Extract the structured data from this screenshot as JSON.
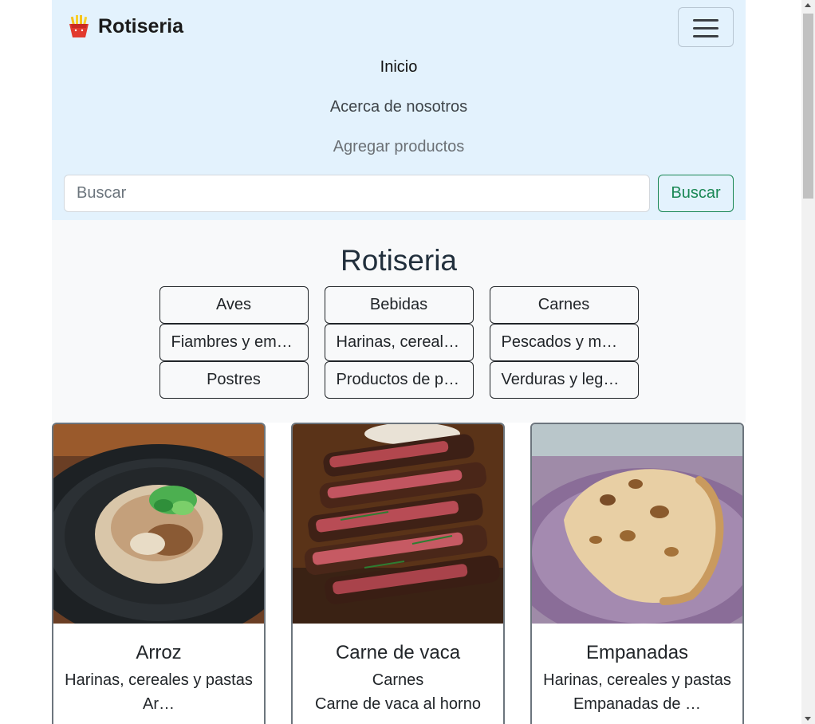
{
  "navbar": {
    "brand": "Rotiseria",
    "brand_icon": "fries-icon",
    "toggler_icon": "hamburger-menu-icon",
    "links": [
      {
        "label": "Inicio",
        "state": "active"
      },
      {
        "label": "Acerca de nosotros",
        "state": "normal"
      },
      {
        "label": "Agregar productos",
        "state": "muted"
      }
    ],
    "search": {
      "placeholder": "Buscar",
      "value": "",
      "button_label": "Buscar"
    },
    "colors": {
      "background": "#e3f2fd",
      "search_button": "#198754"
    }
  },
  "categories": {
    "title": "Rotiseria",
    "items": [
      "Aves",
      "Bebidas",
      "Carnes",
      "Fiambres y em…",
      "Harinas, cereal…",
      "Pescados y m…",
      "Postres",
      "Productos de p…",
      "Verduras y leg…"
    ]
  },
  "products": [
    {
      "title": "Arroz",
      "category": "Harinas, cereales y pastas",
      "description": "Ar…",
      "image": "rice-bowl-photo"
    },
    {
      "title": "Carne de vaca",
      "category": "Carnes",
      "description": "Carne de vaca al horno",
      "image": "sliced-steak-photo"
    },
    {
      "title": "Empanadas",
      "category": "Harinas, cereales y pastas",
      "description": "Empanadas de …",
      "image": "empanada-photo"
    }
  ]
}
